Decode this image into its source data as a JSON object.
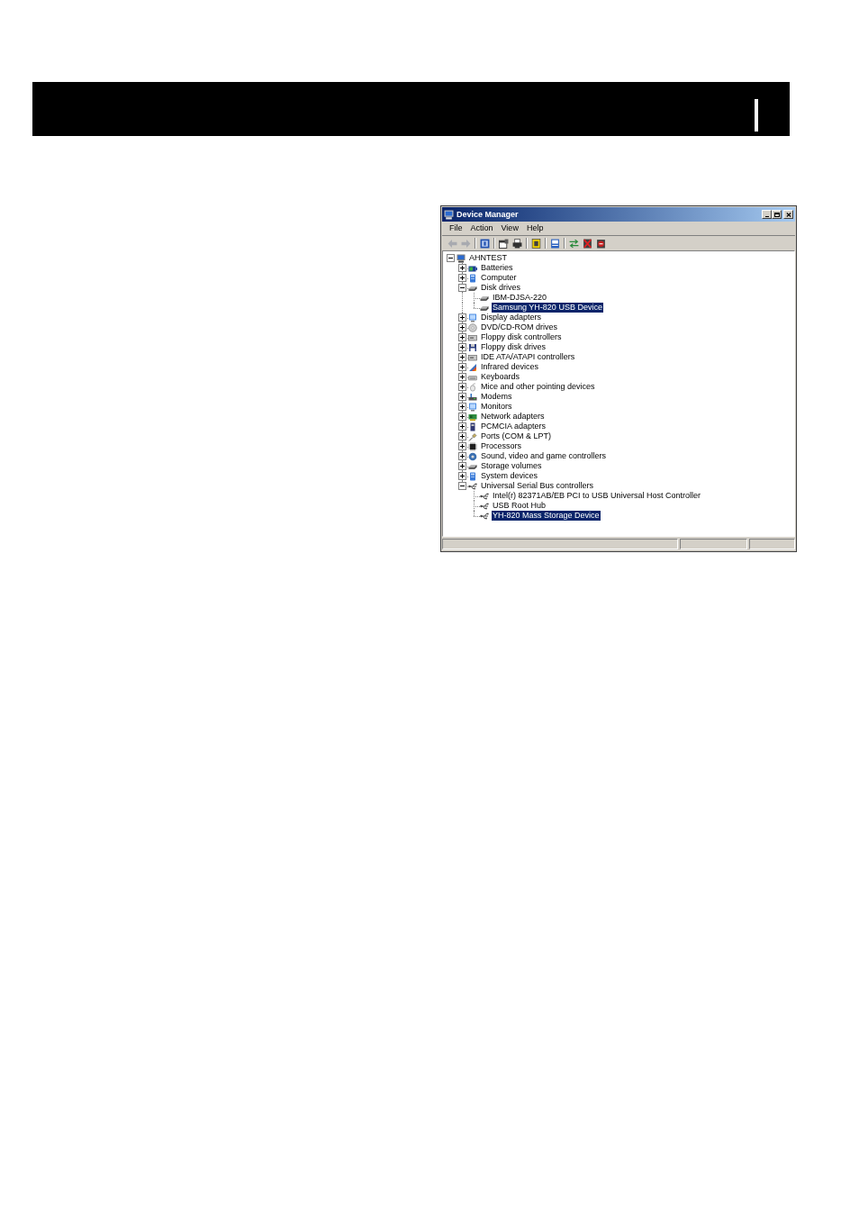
{
  "window": {
    "title": "Device Manager"
  },
  "menu_bar": [
    "File",
    "Action",
    "View",
    "Help"
  ],
  "toolbar": [
    {
      "buttons": [
        {
          "kind": "back",
          "disabled": true
        },
        {
          "kind": "forward",
          "disabled": true
        }
      ]
    },
    {
      "buttons": [
        {
          "kind": "details",
          "disabled": false
        }
      ]
    },
    {
      "buttons": [
        {
          "kind": "properties",
          "disabled": false
        },
        {
          "kind": "print",
          "disabled": false
        }
      ]
    },
    {
      "buttons": [
        {
          "kind": "help",
          "disabled": false
        }
      ]
    },
    {
      "buttons": [
        {
          "kind": "scan",
          "disabled": false
        }
      ]
    },
    {
      "buttons": [
        {
          "kind": "update",
          "disabled": false
        },
        {
          "kind": "uninstall",
          "disabled": false
        },
        {
          "kind": "disable",
          "disabled": false
        }
      ]
    }
  ],
  "tree": [
    {
      "label": "AHNTEST",
      "kind": "computer",
      "expanded": true,
      "selected": false,
      "children": [
        {
          "label": "Batteries",
          "kind": "battery",
          "expanded": false,
          "selected": false
        },
        {
          "label": "Computer",
          "kind": "pc",
          "expanded": false,
          "selected": false
        },
        {
          "label": "Disk drives",
          "kind": "drive",
          "expanded": true,
          "selected": false,
          "children": [
            {
              "label": "IBM-DJSA-220",
              "kind": "drive",
              "selected": false
            },
            {
              "label": "Samsung YH-820 USB Device",
              "kind": "drive",
              "selected": true
            }
          ]
        },
        {
          "label": "Display adapters",
          "kind": "monitor",
          "expanded": false,
          "selected": false
        },
        {
          "label": "DVD/CD-ROM drives",
          "kind": "disc",
          "expanded": false,
          "selected": false
        },
        {
          "label": "Floppy disk controllers",
          "kind": "controller",
          "expanded": false,
          "selected": false
        },
        {
          "label": "Floppy disk drives",
          "kind": "floppy",
          "expanded": false,
          "selected": false
        },
        {
          "label": "IDE ATA/ATAPI controllers",
          "kind": "controller",
          "expanded": false,
          "selected": false
        },
        {
          "label": "Infrared devices",
          "kind": "infrared",
          "expanded": false,
          "selected": false
        },
        {
          "label": "Keyboards",
          "kind": "keyboard",
          "expanded": false,
          "selected": false
        },
        {
          "label": "Mice and other pointing devices",
          "kind": "mouse",
          "expanded": false,
          "selected": false
        },
        {
          "label": "Modems",
          "kind": "modem",
          "expanded": false,
          "selected": false
        },
        {
          "label": "Monitors",
          "kind": "monitor",
          "expanded": false,
          "selected": false
        },
        {
          "label": "Network adapters",
          "kind": "network",
          "expanded": false,
          "selected": false
        },
        {
          "label": "PCMCIA adapters",
          "kind": "pccard",
          "expanded": false,
          "selected": false
        },
        {
          "label": "Ports (COM & LPT)",
          "kind": "port",
          "expanded": false,
          "selected": false
        },
        {
          "label": "Processors",
          "kind": "chip",
          "expanded": false,
          "selected": false
        },
        {
          "label": "Sound, video and game controllers",
          "kind": "speaker",
          "expanded": false,
          "selected": false
        },
        {
          "label": "Storage volumes",
          "kind": "drive",
          "expanded": false,
          "selected": false
        },
        {
          "label": "System devices",
          "kind": "pc",
          "expanded": false,
          "selected": false
        },
        {
          "label": "Universal Serial Bus controllers",
          "kind": "usb",
          "expanded": true,
          "selected": false,
          "children": [
            {
              "label": "Intel(r) 82371AB/EB PCI to USB Universal Host Controller",
              "kind": "usb",
              "selected": false
            },
            {
              "label": "USB Root Hub",
              "kind": "usb",
              "selected": false
            },
            {
              "label": "YH-820 Mass Storage Device",
              "kind": "usb",
              "selected": true
            }
          ]
        }
      ]
    }
  ]
}
